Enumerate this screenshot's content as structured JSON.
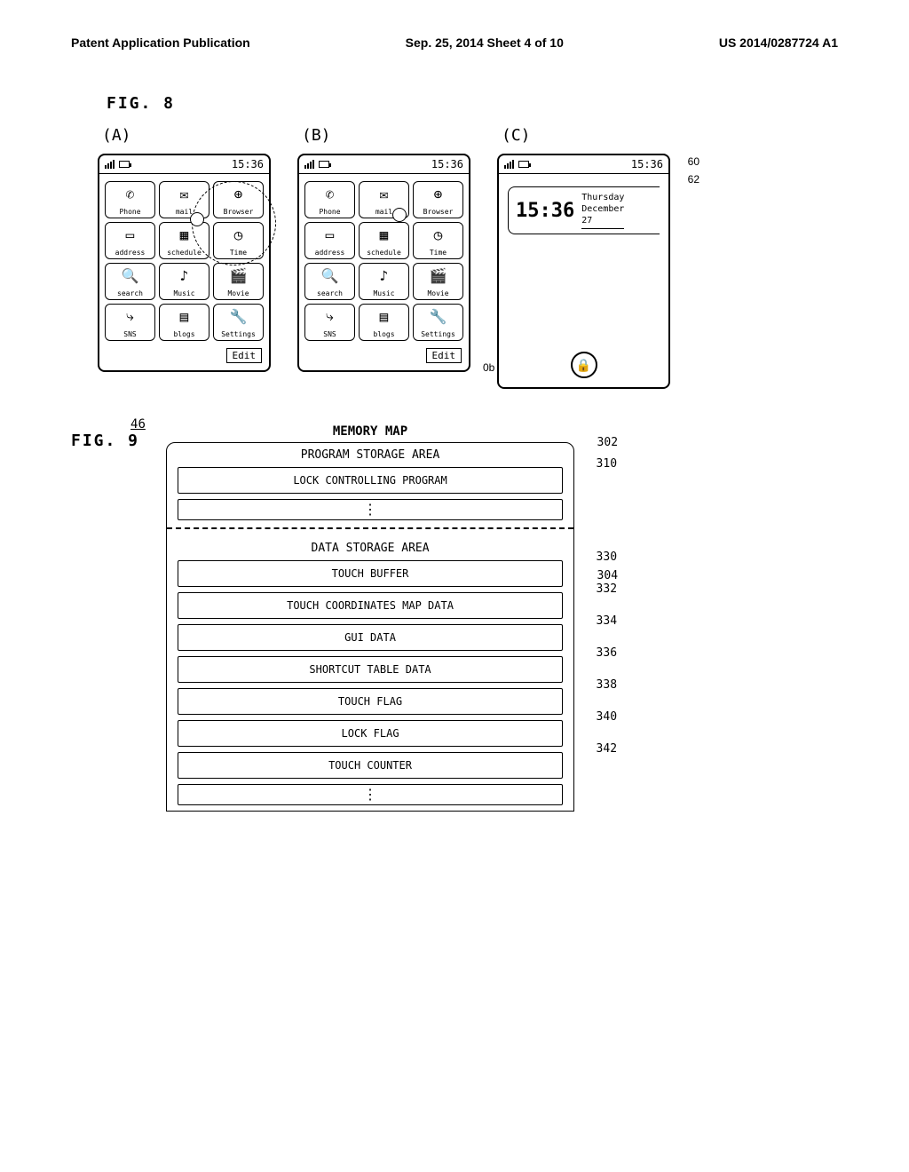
{
  "header": {
    "left": "Patent Application Publication",
    "center": "Sep. 25, 2014  Sheet 4 of 10",
    "right": "US 2014/0287724 A1"
  },
  "fig8": {
    "label": "FIG. 8",
    "panels": [
      "(A)",
      "(B)",
      "(C)"
    ],
    "status_time": "15:36",
    "apps": [
      {
        "label": "Phone",
        "glyph": "✆"
      },
      {
        "label": "mail",
        "glyph": "✉"
      },
      {
        "label": "Browser",
        "glyph": "⊕"
      },
      {
        "label": "address",
        "glyph": "▭"
      },
      {
        "label": "schedule",
        "glyph": "▦"
      },
      {
        "label": "Time",
        "glyph": "◷"
      },
      {
        "label": "search",
        "glyph": "🔍"
      },
      {
        "label": "Music",
        "glyph": "♪"
      },
      {
        "label": "Movie",
        "glyph": "🎬"
      },
      {
        "label": "SNS",
        "glyph": "⤷"
      },
      {
        "label": "blogs",
        "glyph": "▤"
      },
      {
        "label": "Settings",
        "glyph": "🔧"
      }
    ],
    "edit_label": "Edit",
    "clock": {
      "time": "15:36",
      "day": "Thursday",
      "month": "December",
      "date": "27"
    },
    "callouts": {
      "c60": "60",
      "c62": "62",
      "ob": "0b"
    }
  },
  "fig9": {
    "label": "FIG. 9",
    "ref46": "46",
    "title": "MEMORY MAP",
    "program_area": "PROGRAM STORAGE AREA",
    "lock_prog": "LOCK CONTROLLING PROGRAM",
    "data_area": "DATA STORAGE AREA",
    "items": [
      "TOUCH BUFFER",
      "TOUCH COORDINATES MAP DATA",
      "GUI DATA",
      "SHORTCUT TABLE DATA",
      "TOUCH FLAG",
      "LOCK FLAG",
      "TOUCH COUNTER"
    ],
    "refs": {
      "r302": "302",
      "r310": "310",
      "r304": "304",
      "r330": "330",
      "r332": "332",
      "r334": "334",
      "r336": "336",
      "r338": "338",
      "r340": "340",
      "r342": "342"
    }
  }
}
